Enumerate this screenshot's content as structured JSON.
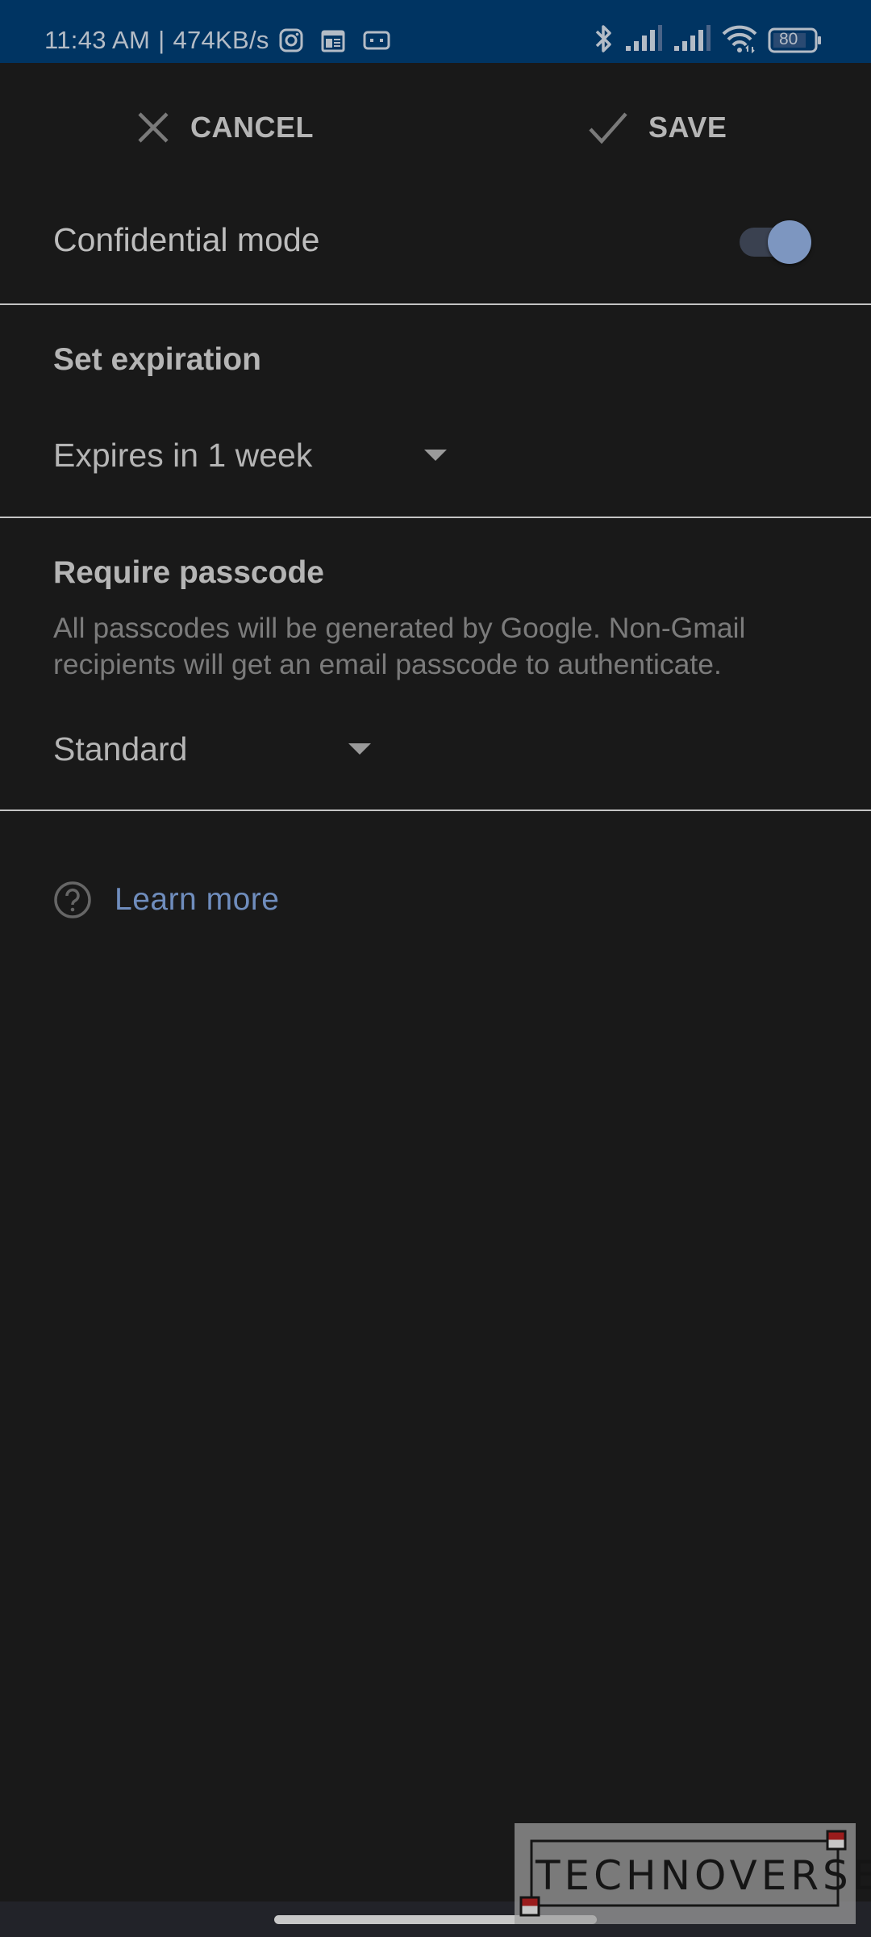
{
  "status_bar": {
    "time": "11:43 AM",
    "separator": "|",
    "network_speed": "474KB/s",
    "left_icons": [
      "instagram-icon",
      "calendar-icon",
      "cassette-icon"
    ],
    "right_icons": [
      "bluetooth-icon",
      "signal-sim1-icon",
      "signal-sim2-icon",
      "wifi-icon",
      "battery-icon"
    ],
    "battery_level": "80"
  },
  "toolbar": {
    "cancel_label": "CANCEL",
    "save_label": "SAVE"
  },
  "confidential_mode": {
    "label": "Confidential mode",
    "enabled": true,
    "accent_color": "#7d96c0"
  },
  "expiration": {
    "title": "Set expiration",
    "selected": "Expires in 1 week"
  },
  "passcode": {
    "title": "Require passcode",
    "description": "All passcodes will be generated by Google. Non-Gmail recipients will get an email passcode to authenticate.",
    "selected": "Standard"
  },
  "help": {
    "link_label": "Learn more",
    "link_color": "#6f8dbd"
  },
  "watermark": {
    "text": "TECHNOVERSE"
  }
}
